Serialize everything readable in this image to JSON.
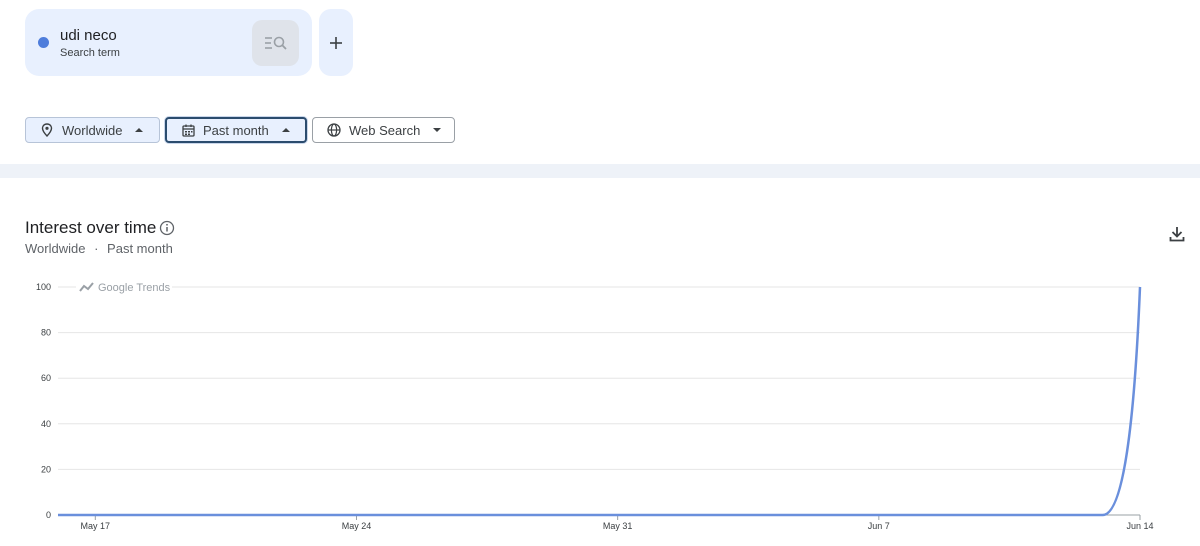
{
  "search_term": {
    "name": "udi neco",
    "type": "Search term",
    "color": "#4e7ddb",
    "search_icon": "search-list-icon",
    "add_icon": "plus-icon"
  },
  "filters": {
    "region": {
      "label": "Worldwide",
      "icon": "location-pin-icon",
      "caret": "caret-up-icon"
    },
    "time": {
      "label": "Past month",
      "icon": "calendar-icon",
      "caret": "caret-up-icon"
    },
    "property": {
      "label": "Web Search",
      "icon": "globe-icon",
      "caret": "caret-down-icon"
    }
  },
  "section": {
    "title": "Interest over time",
    "subtitle_region": "Worldwide",
    "subtitle_sep": "·",
    "subtitle_time": "Past month",
    "info_icon": "info-icon",
    "download_icon": "download-icon"
  },
  "chart_data": {
    "type": "line",
    "watermark": "Google Trends",
    "ylim": [
      0,
      100
    ],
    "y_ticks": [
      0,
      20,
      40,
      60,
      80,
      100
    ],
    "x_tick_labels": [
      "May 17",
      "May 24",
      "May 31",
      "Jun 7",
      "Jun 14"
    ],
    "grid": true,
    "series": [
      {
        "color": "#6a8fdc",
        "x": [
          "May 16",
          "May 17",
          "May 18",
          "May 19",
          "May 20",
          "May 21",
          "May 22",
          "May 23",
          "May 24",
          "May 25",
          "May 26",
          "May 27",
          "May 28",
          "May 29",
          "May 30",
          "May 31",
          "Jun 1",
          "Jun 2",
          "Jun 3",
          "Jun 4",
          "Jun 5",
          "Jun 6",
          "Jun 7",
          "Jun 8",
          "Jun 9",
          "Jun 10",
          "Jun 11",
          "Jun 12",
          "Jun 13",
          "Jun 14"
        ],
        "values": [
          0,
          0,
          0,
          0,
          0,
          0,
          0,
          0,
          0,
          0,
          0,
          0,
          0,
          0,
          0,
          0,
          0,
          0,
          0,
          0,
          0,
          0,
          0,
          0,
          0,
          0,
          0,
          0,
          0,
          100
        ]
      }
    ]
  }
}
